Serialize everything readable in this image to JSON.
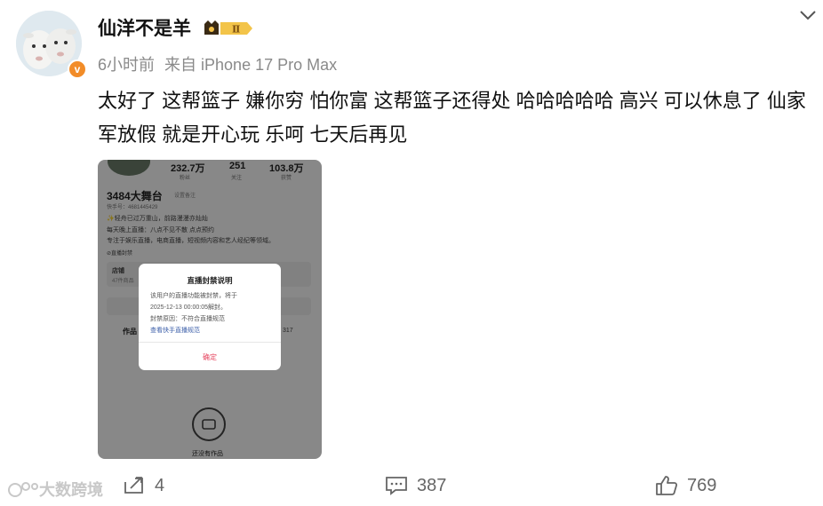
{
  "post": {
    "username": "仙洋不是羊",
    "badge_level": "Ⅱ",
    "time": "6小时前",
    "source": "来自 iPhone 17 Pro Max",
    "text": "太好了 这帮篮子 嫌你穷 怕你富 这帮篮子还得处 哈哈哈哈哈 高兴 可以休息了 仙家军放假 就是开心玩 乐呵 七天后再见"
  },
  "screenshot": {
    "stats": [
      {
        "value": "232.7万",
        "label": "粉丝"
      },
      {
        "value": "251",
        "label": "关注"
      },
      {
        "value": "103.8万",
        "label": "获赞"
      }
    ],
    "profile_name": "3484大舞台",
    "profile_tag": "设置备注",
    "kuaishou_id": "快手号：4681445429",
    "bio_lines": [
      "✨轻舟已过万重山，前路漫漫亦灿灿",
      "每天晚上直播：八点不见不散 点点预约",
      "专注于娱乐直播，电商直播，短视频内容和艺人经纪等领域。"
    ],
    "banned_label": "⊘直播封禁",
    "shop_label": "店铺",
    "shop_sub": "47件商品",
    "tab_works": "作品",
    "count_right": "317",
    "empty_text": "还没有作品",
    "dialog": {
      "title": "直播封禁说明",
      "line1": "该用户的直播功能被封禁，将于",
      "line2": "2025-12-13 00:00:05解封。",
      "line3": "封禁原因：不符合直播规范",
      "link": "查看快手直播规范",
      "confirm": "确定"
    }
  },
  "actions": {
    "share_count": "4",
    "comment_count": "387",
    "like_count": "769"
  },
  "watermark": "大数跨境",
  "colors": {
    "accent": "#f28c28",
    "link": "#3a5da8",
    "confirm": "#e64660"
  }
}
